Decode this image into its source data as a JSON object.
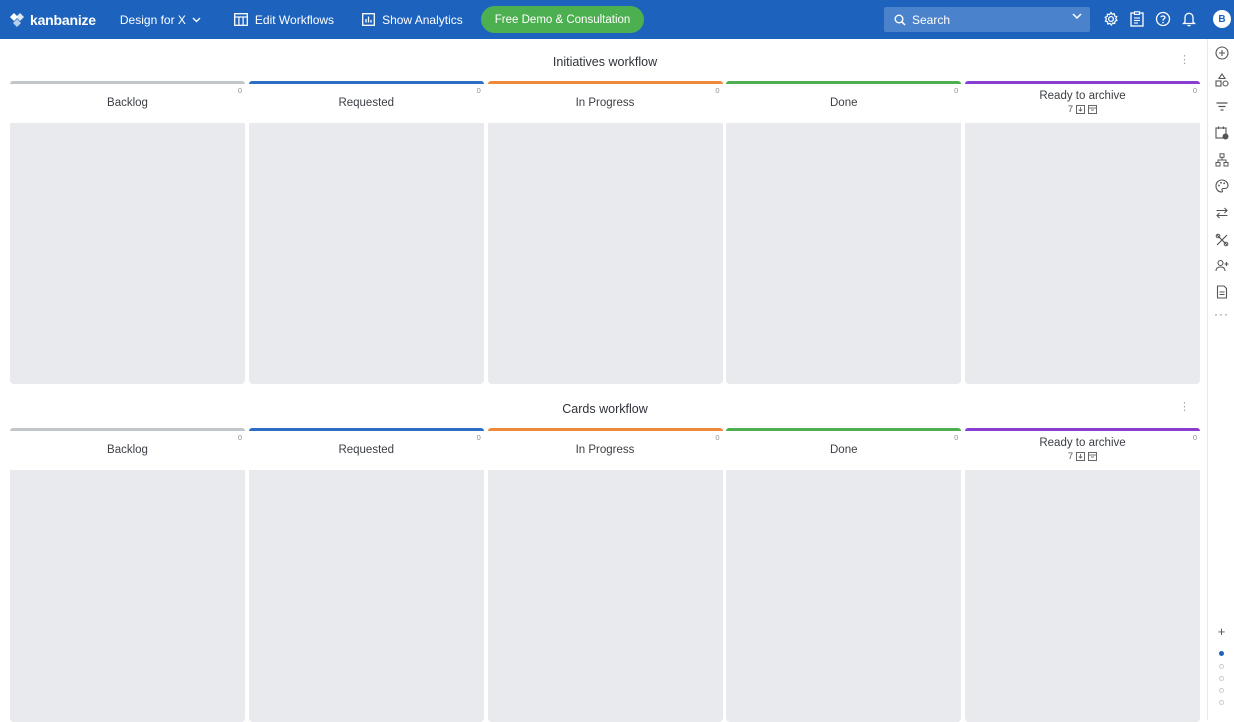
{
  "topbar": {
    "logo_text": "kanbanize",
    "board_name": "Design for X",
    "edit_workflows": "Edit Workflows",
    "show_analytics": "Show Analytics",
    "demo_button": "Free Demo & Consultation",
    "search_placeholder": "Search",
    "avatar_initial": "B",
    "icons": [
      "settings-icon",
      "clipboard-icon",
      "help-icon",
      "bell-icon"
    ]
  },
  "workflows": [
    {
      "title": "Initiatives workflow",
      "menu": "⋮",
      "columns": [
        {
          "label": "Backlog",
          "count": "0",
          "color": "#c2c6cc"
        },
        {
          "label": "Requested",
          "count": "0",
          "color": "#2b6ec4"
        },
        {
          "label": "In Progress",
          "count": "0",
          "color": "#f08a3a"
        },
        {
          "label": "Done",
          "count": "0",
          "color": "#4caf50"
        },
        {
          "label": "Ready to archive",
          "count": "0",
          "color": "#8a3dd1",
          "archive_count": "7"
        }
      ]
    },
    {
      "title": "Cards workflow",
      "menu": "⋮",
      "columns": [
        {
          "label": "Backlog",
          "count": "0",
          "color": "#c2c6cc"
        },
        {
          "label": "Requested",
          "count": "0",
          "color": "#2b6ec4"
        },
        {
          "label": "In Progress",
          "count": "0",
          "color": "#f08a3a"
        },
        {
          "label": "Done",
          "count": "0",
          "color": "#4caf50"
        },
        {
          "label": "Ready to archive",
          "count": "0",
          "color": "#8a3dd1",
          "archive_count": "7"
        }
      ]
    }
  ],
  "rightbar": {
    "icons": [
      "add-circle-icon",
      "shapes-icon",
      "filter-icon",
      "calendar-clock-icon",
      "hierarchy-icon",
      "palette-icon",
      "swap-icon",
      "tools-icon",
      "add-user-icon",
      "document-icon"
    ],
    "more": "···",
    "plus": "+"
  },
  "colors": {
    "topbar": "#1d63bd",
    "demo_button": "#4caf50",
    "column_body": "#e8eaed"
  }
}
